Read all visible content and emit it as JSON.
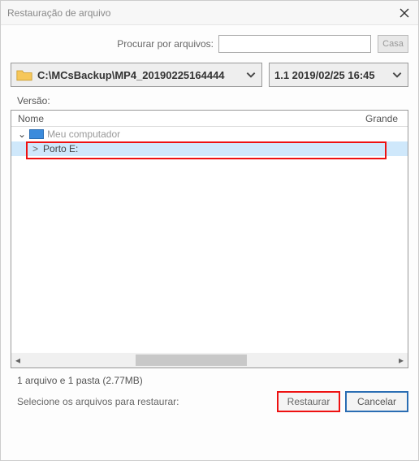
{
  "titlebar": {
    "title": "Restauração de arquivo"
  },
  "search": {
    "label": "Procurar por arquivos:",
    "value": "",
    "casa": "Casa"
  },
  "path_dropdown": {
    "text": "C:\\MCsBackup\\MP4_20190225164444"
  },
  "version_dropdown": {
    "text": "1.1  2019/02/25 16:45"
  },
  "version_label": "Versão:",
  "columns": {
    "nome": "Nome",
    "grande": "Grande"
  },
  "tree": {
    "root": {
      "label": "Meu computador"
    },
    "child": {
      "label": "Porto E:"
    }
  },
  "footer": {
    "status": "1 arquivo e 1 pasta (2.77MB)",
    "hint": "Selecione os arquivos para restaurar:",
    "restore": "Restaurar",
    "cancel": "Cancelar"
  }
}
